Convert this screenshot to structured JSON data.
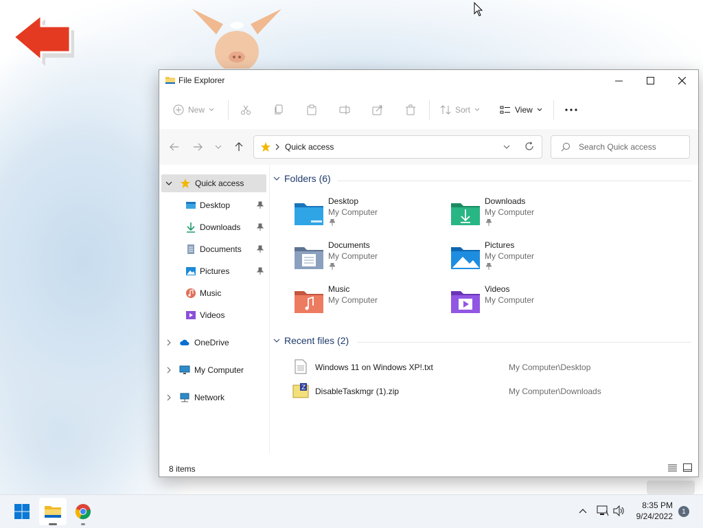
{
  "window": {
    "title": "File Explorer"
  },
  "toolbar": {
    "new_label": "New",
    "sort_label": "Sort",
    "view_label": "View"
  },
  "address": {
    "location": "Quick access",
    "search_placeholder": "Search Quick access"
  },
  "nav": {
    "quick_access": "Quick access",
    "items": [
      {
        "label": "Desktop"
      },
      {
        "label": "Downloads"
      },
      {
        "label": "Documents"
      },
      {
        "label": "Pictures"
      },
      {
        "label": "Music"
      },
      {
        "label": "Videos"
      }
    ],
    "onedrive": "OneDrive",
    "my_computer": "My Computer",
    "network": "Network"
  },
  "folders": {
    "header": "Folders (6)",
    "items": [
      {
        "name": "Desktop",
        "location": "My Computer"
      },
      {
        "name": "Downloads",
        "location": "My Computer"
      },
      {
        "name": "Documents",
        "location": "My Computer"
      },
      {
        "name": "Pictures",
        "location": "My Computer"
      },
      {
        "name": "Music",
        "location": "My Computer"
      },
      {
        "name": "Videos",
        "location": "My Computer"
      }
    ]
  },
  "recent": {
    "header": "Recent files (2)",
    "items": [
      {
        "name": "Windows 11 on Windows XP!.txt",
        "location": "My Computer\\Desktop"
      },
      {
        "name": "DisableTaskmgr (1).zip",
        "location": "My Computer\\Downloads"
      }
    ]
  },
  "status": {
    "item_count": "8 items"
  },
  "taskbar": {
    "time": "8:35 PM",
    "date": "9/24/2022",
    "notification_count": "1"
  },
  "colors": {
    "accent": "#0067c0",
    "section_heading": "#1e3a6b",
    "selected_nav": "#e0e0e0"
  }
}
